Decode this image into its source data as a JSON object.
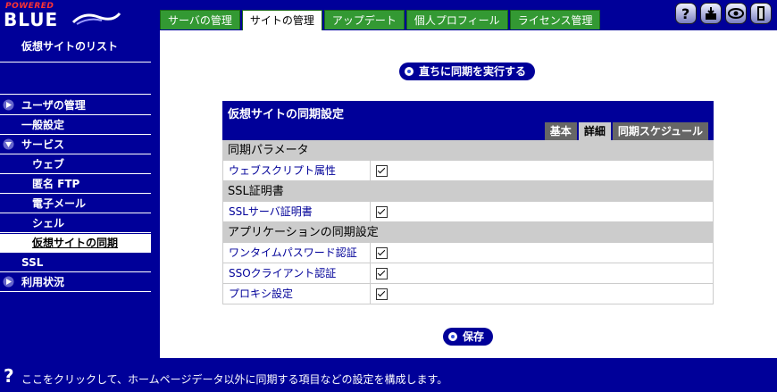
{
  "logo": {
    "powered": "POWERED",
    "brand": "BLUE"
  },
  "tabs": [
    {
      "label": "サーバの管理",
      "active": false
    },
    {
      "label": "サイトの管理",
      "active": true
    },
    {
      "label": "アップデート",
      "active": false
    },
    {
      "label": "個人プロフィール",
      "active": false
    },
    {
      "label": "ライセンス管理",
      "active": false
    }
  ],
  "top_icons": [
    {
      "icon": "help-icon"
    },
    {
      "icon": "download-icon"
    },
    {
      "icon": "eye-icon"
    },
    {
      "icon": "logout-icon"
    }
  ],
  "sidebar": {
    "heading": "仮想サイトのリスト",
    "items": [
      {
        "label": "ユーザの管理",
        "level": 1,
        "expandable": true
      },
      {
        "label": "一般設定",
        "level": 1
      },
      {
        "label": "サービス",
        "level": 1,
        "expanded": true
      },
      {
        "label": "ウェブ",
        "level": 2
      },
      {
        "label": "匿名 FTP",
        "level": 2
      },
      {
        "label": "電子メール",
        "level": 2
      },
      {
        "label": "シェル",
        "level": 2
      },
      {
        "label": "仮想サイトの同期",
        "level": 2,
        "selected": true
      },
      {
        "label": "SSL",
        "level": 1
      },
      {
        "label": "利用状況",
        "level": 1,
        "expandable": true
      }
    ]
  },
  "main": {
    "sync_now_button": "直ちに同期を実行する",
    "panel": {
      "title": "仮想サイトの同期設定",
      "tabs": [
        {
          "label": "基本",
          "active": false
        },
        {
          "label": "詳細",
          "active": true
        },
        {
          "label": "同期スケジュール",
          "active": false
        }
      ],
      "sections": [
        {
          "title": "同期パラメータ",
          "rows": [
            {
              "label": "ウェブスクリプト属性",
              "checked": true
            }
          ]
        },
        {
          "title": "SSL証明書",
          "rows": [
            {
              "label": "SSLサーバ証明書",
              "checked": true
            }
          ]
        },
        {
          "title": "アプリケーションの同期設定",
          "rows": [
            {
              "label": "ワンタイムパスワード認証",
              "checked": true
            },
            {
              "label": "SSOクライアント認証",
              "checked": true
            },
            {
              "label": "プロキシ設定",
              "checked": true
            }
          ]
        }
      ]
    },
    "save_button": "保存"
  },
  "footer": {
    "icon": "help-icon",
    "text": "ここをクリックして、ホームページデータ以外に同期する項目などの設定を構成します。"
  },
  "colors": {
    "navy": "#000099",
    "tab_green": "#339933",
    "section_gray": "#cccccc"
  }
}
